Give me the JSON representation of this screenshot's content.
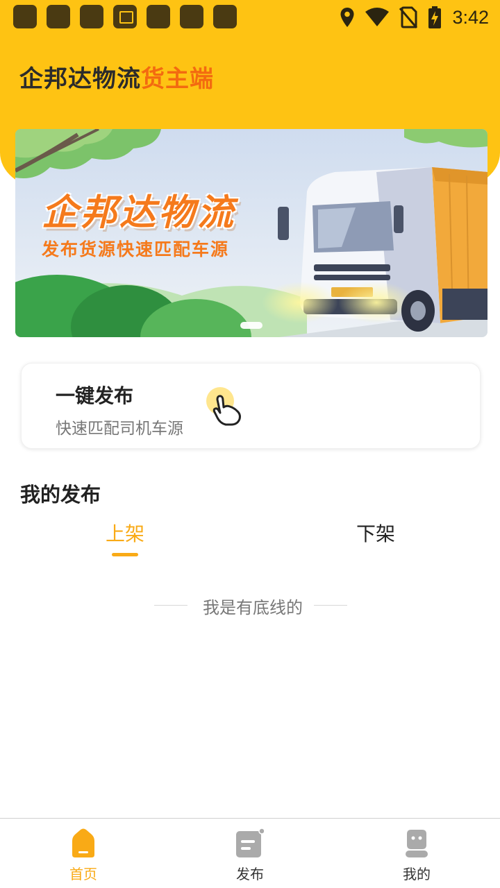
{
  "status_bar": {
    "time": "3:42",
    "notification_icons": [
      "app-icon",
      "app-icon",
      "app-icon",
      "image-icon",
      "app-icon",
      "app-icon",
      "app-icon"
    ],
    "system_icons": [
      "location-icon",
      "wifi-icon",
      "no-sim-icon",
      "battery-charging-icon"
    ]
  },
  "header": {
    "title_main": "企邦达物流",
    "title_accent": "货主端"
  },
  "banner": {
    "title": "企邦达物流",
    "subtitle": "发布货源快速匹配车源",
    "active_slide": 1
  },
  "quick_publish": {
    "title": "一键发布",
    "subtitle": "快速匹配司机车源",
    "icon": "hand-pointer-icon"
  },
  "my_publish": {
    "section_title": "我的发布",
    "tabs": [
      {
        "label": "上架",
        "active": true
      },
      {
        "label": "下架",
        "active": false
      }
    ],
    "end_text": "我是有底线的"
  },
  "bottom_nav": {
    "items": [
      {
        "label": "首页",
        "icon": "home-icon",
        "active": true
      },
      {
        "label": "发布",
        "icon": "publish-icon",
        "active": false
      },
      {
        "label": "我的",
        "icon": "profile-icon",
        "active": false
      }
    ]
  },
  "colors": {
    "header_yellow": "#FEC313",
    "accent_orange": "#F36A10",
    "active_tab": "#F9AA16",
    "banner_text": "#F57A1C"
  }
}
